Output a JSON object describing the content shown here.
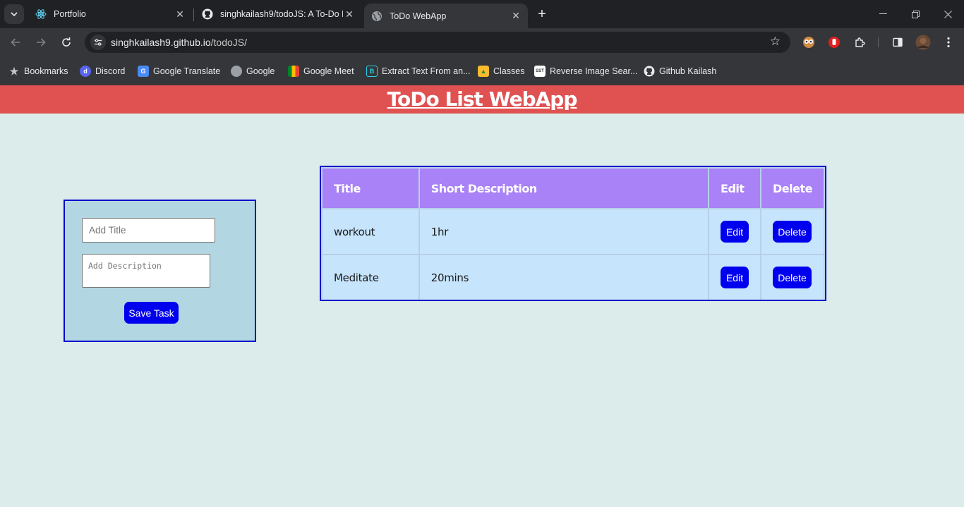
{
  "browser": {
    "tabs": [
      {
        "title": "Portfolio",
        "icon": "react-icon",
        "active": false
      },
      {
        "title": "singhkailash9/todoJS: A To-Do L",
        "icon": "github-icon",
        "active": false
      },
      {
        "title": "ToDo WebApp",
        "icon": "globe-icon",
        "active": true
      }
    ],
    "url_host": "singhkailash9.github.io",
    "url_path": "/todoJS/",
    "bookmarks": [
      {
        "label": "Bookmarks",
        "icon": "star-icon"
      },
      {
        "label": "Discord",
        "icon": "discord-icon"
      },
      {
        "label": "Google Translate",
        "icon": "google-translate-icon"
      },
      {
        "label": "Google",
        "icon": "globe-icon"
      },
      {
        "label": "Google Meet",
        "icon": "google-meet-icon"
      },
      {
        "label": "Extract Text From an...",
        "icon": "extract-text-icon"
      },
      {
        "label": "Classes",
        "icon": "classroom-icon"
      },
      {
        "label": "Reverse Image Sear...",
        "icon": "sst-icon"
      },
      {
        "label": "Github Kailash",
        "icon": "github-icon"
      }
    ]
  },
  "app": {
    "title": "ToDo List WebApp",
    "form": {
      "title_placeholder": "Add Title",
      "description_placeholder": "Add Description",
      "save_label": "Save Task"
    },
    "table": {
      "headers": [
        "Title",
        "Short Description",
        "Edit",
        "Delete"
      ],
      "rows": [
        {
          "title": "workout",
          "description": "1hr",
          "edit_label": "Edit",
          "delete_label": "Delete"
        },
        {
          "title": "Meditate",
          "description": "20mins",
          "edit_label": "Edit",
          "delete_label": "Delete"
        }
      ]
    }
  },
  "colors": {
    "header_bg": "#e05252",
    "page_bg": "#dceceb",
    "form_bg": "#b3d7e2",
    "table_header_bg": "#a882f6",
    "table_cell_bg": "#c6e4fc",
    "button_bg": "#0000ee",
    "border": "#0000cc"
  }
}
